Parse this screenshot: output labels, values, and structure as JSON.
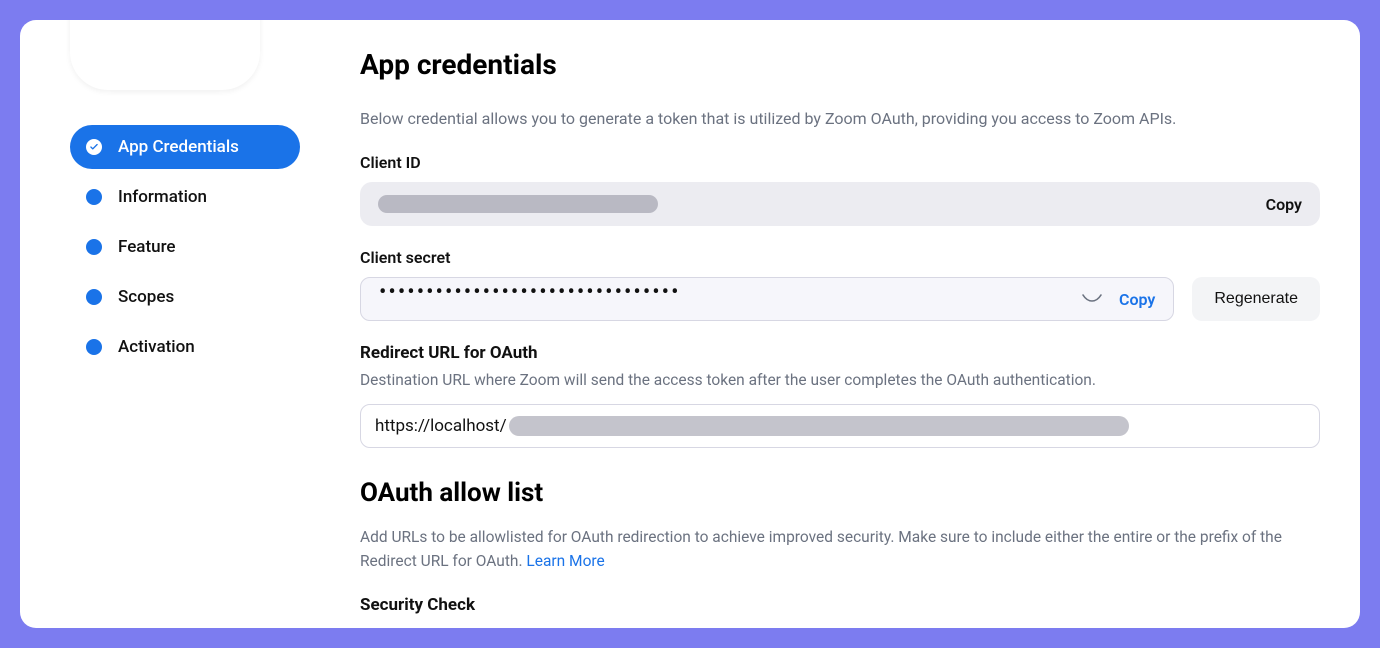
{
  "sidebar": {
    "items": [
      {
        "label": "App Credentials",
        "active": true,
        "icon": "check-circle-icon"
      },
      {
        "label": "Information",
        "active": false,
        "icon": "circle-dot-icon"
      },
      {
        "label": "Feature",
        "active": false,
        "icon": "circle-dot-icon"
      },
      {
        "label": "Scopes",
        "active": false,
        "icon": "circle-dot-icon"
      },
      {
        "label": "Activation",
        "active": false,
        "icon": "circle-dot-icon"
      }
    ]
  },
  "main": {
    "title": "App credentials",
    "description": "Below credential allows you to generate a token that is utilized by Zoom OAuth, providing you access to Zoom APIs.",
    "client_id_label": "Client ID",
    "client_id_copy": "Copy",
    "client_secret_label": "Client secret",
    "client_secret_value": "••••••••••••••••••••••••••••••••",
    "client_secret_copy": "Copy",
    "regenerate_label": "Regenerate",
    "redirect_heading": "Redirect URL for OAuth",
    "redirect_desc": "Destination URL where Zoom will send the access token after the user completes the OAuth authentication.",
    "redirect_value": "https://localhost/",
    "oauth_allow_title": "OAuth allow list",
    "oauth_allow_desc": "Add URLs to be allowlisted for OAuth redirection to achieve improved security. Make sure to include either the entire or the prefix of the Redirect URL for OAuth. ",
    "learn_more": "Learn More",
    "security_check": "Security Check"
  }
}
